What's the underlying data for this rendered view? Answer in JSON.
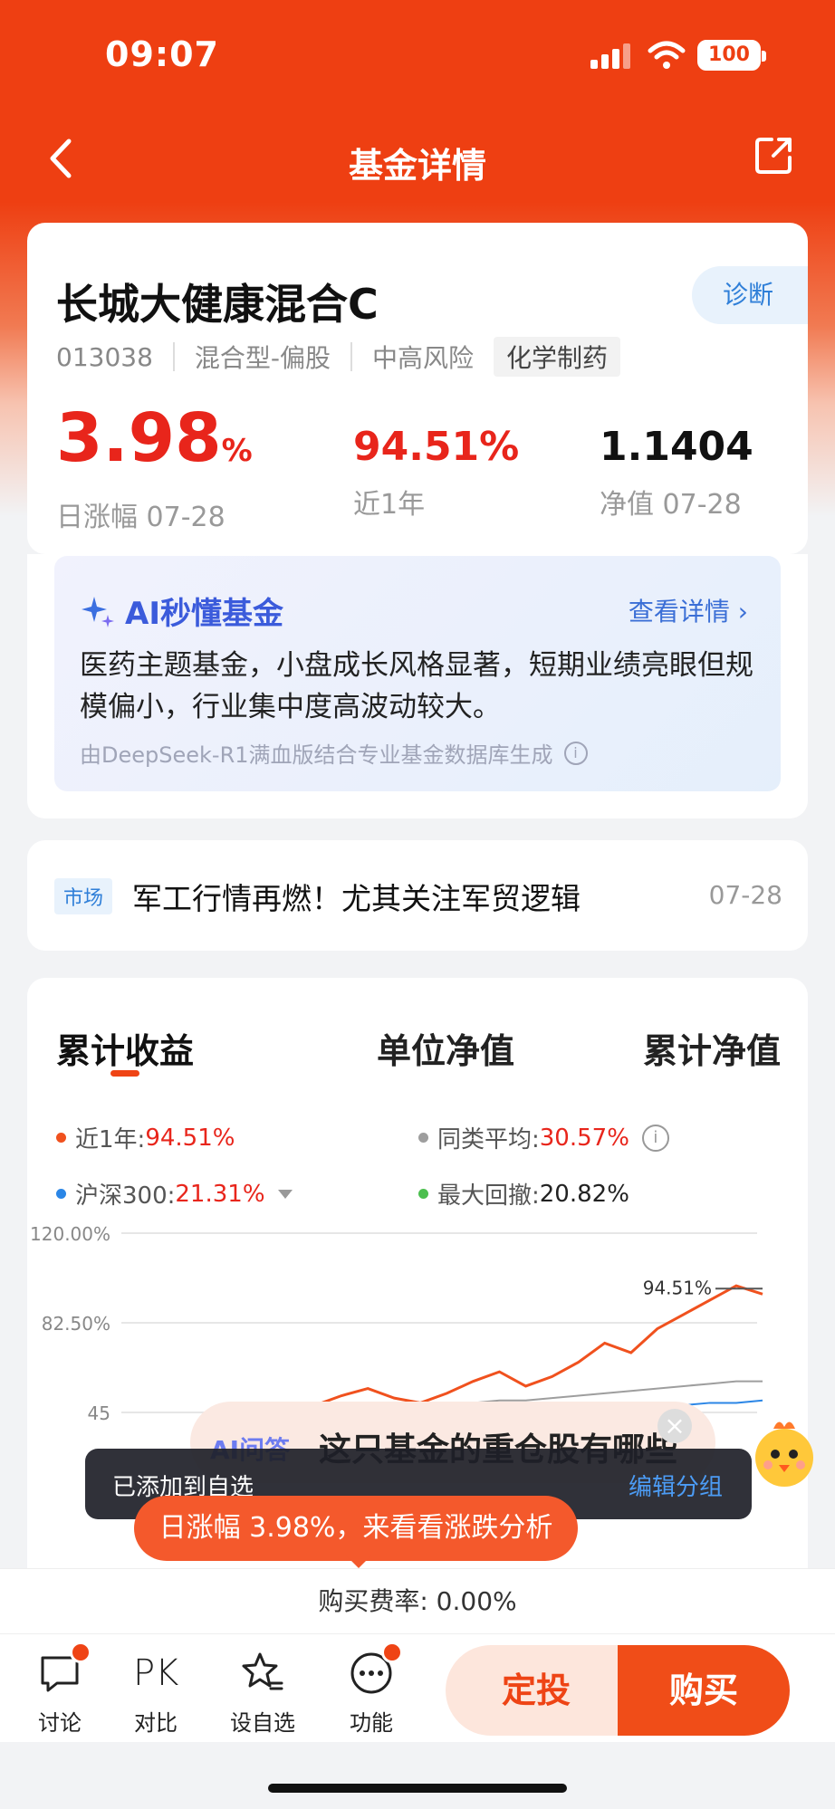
{
  "status_bar": {
    "time": "09:07",
    "battery": "100"
  },
  "nav": {
    "title": "基金详情"
  },
  "fund": {
    "name": "长城大健康混合C",
    "diagnose_label": "诊断",
    "code": "013038",
    "type": "混合型-偏股",
    "risk": "中高风险",
    "sector": "化学制药",
    "day_change": {
      "value": "3.98",
      "unit": "%",
      "label": "日涨幅 07-28"
    },
    "year_return": {
      "value": "94.51%",
      "label": "近1年"
    },
    "nav_value": {
      "value": "1.1404",
      "label": "净值 07-28"
    }
  },
  "ai_summary": {
    "title": "AI秒懂基金",
    "more_label": "查看详情",
    "text": "医药主题基金，小盘成长风格显著，短期业绩亮眼但规模偏小，行业集中度高波动较大。",
    "footnote": "由DeepSeek-R1满血版结合专业基金数据库生成"
  },
  "news": {
    "tag": "市场",
    "title": "军工行情再燃！尤其关注军贸逻辑",
    "date": "07-28"
  },
  "chart_section": {
    "tabs": [
      "累计收益",
      "单位净值",
      "累计净值"
    ],
    "legend": [
      {
        "label": "近1年:",
        "value": "94.51%",
        "color": "#f0511e"
      },
      {
        "label": "同类平均:",
        "value": "30.57%",
        "color": "#9e9e9e"
      },
      {
        "label": "沪深300:",
        "value": "21.31%",
        "color": "#2b86e6"
      },
      {
        "label": "最大回撤:",
        "value": "20.82%",
        "color": "#4cbf4f"
      }
    ]
  },
  "chart_data": {
    "type": "line",
    "ylim": [
      45,
      120
    ],
    "y_ticks": [
      "120.00%",
      "82.50%",
      "45"
    ],
    "end_label": "94.51%",
    "series": [
      {
        "name": "近1年",
        "color": "#f0511e",
        "values": [
          47,
          46,
          48,
          52,
          55,
          51,
          49,
          53,
          58,
          62,
          56,
          60,
          66,
          74,
          70,
          80,
          86,
          92,
          98,
          94.51
        ]
      },
      {
        "name": "同类平均",
        "color": "#9e9e9e",
        "values": [
          45,
          45,
          46,
          46,
          47,
          47,
          48,
          48,
          49,
          50,
          50,
          51,
          52,
          53,
          54,
          55,
          56,
          57,
          58,
          58
        ]
      },
      {
        "name": "沪深300",
        "color": "#2b86e6",
        "values": [
          44,
          44,
          44,
          45,
          45,
          44,
          44,
          45,
          45,
          46,
          45,
          46,
          46,
          47,
          47,
          48,
          48,
          49,
          49,
          50
        ]
      }
    ]
  },
  "ai_float": {
    "prefix": "AI问答",
    "question": "这只基金的重仓股有哪些"
  },
  "ai_pill": "日涨幅 3.98%，来看看涨跌分析",
  "toast": {
    "message": "已添加到自选",
    "action": "编辑分组"
  },
  "fee": "购买费率: 0.00%",
  "bottom_nav": [
    {
      "label": "讨论",
      "icon": "chat-bubble-icon"
    },
    {
      "label": "对比",
      "icon_text": "PK"
    },
    {
      "label": "设自选",
      "icon": "star-list-icon"
    },
    {
      "label": "功能",
      "icon": "more-dots-icon"
    }
  ],
  "actions": {
    "auto_invest": "定投",
    "buy": "购买"
  }
}
